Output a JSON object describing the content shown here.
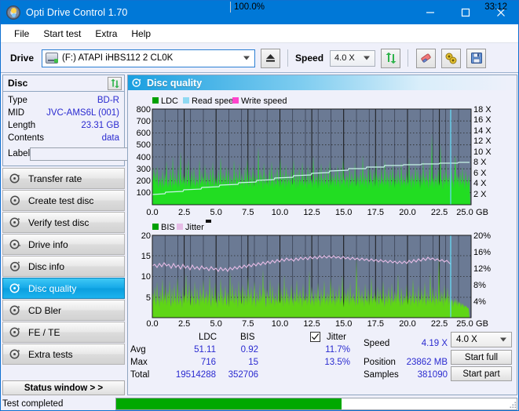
{
  "window": {
    "title": "Opti Drive Control 1.70",
    "icon": "disc-icon",
    "minimize": "–",
    "maximize": "□",
    "close": "✕"
  },
  "menu": {
    "items": [
      {
        "label": "File",
        "name": "menu-file"
      },
      {
        "label": "Start test",
        "name": "menu-start-test"
      },
      {
        "label": "Extra",
        "name": "menu-extra"
      },
      {
        "label": "Help",
        "name": "menu-help"
      }
    ]
  },
  "toolbar": {
    "drive_label": "Drive",
    "drive_value": "(F:)   ATAPI iHBS112  2 CL0K",
    "eject_icon": "eject-icon",
    "speed_label": "Speed",
    "speed_value": "4.0 X",
    "refresh_icon": "refresh-icon",
    "eraser_icon": "eraser-icon",
    "tools_icon": "tools-icon",
    "save_icon": "save-icon"
  },
  "disc_panel": {
    "title": "Disc",
    "refresh_icon": "refresh-icon",
    "rows": [
      {
        "key": "Type",
        "value": "BD-R"
      },
      {
        "key": "MID",
        "value": "JVC-AMS6L (001)"
      },
      {
        "key": "Length",
        "value": "23.31 GB"
      },
      {
        "key": "Contents",
        "value": "data"
      }
    ],
    "label_key": "Label",
    "label_value": "",
    "label_placeholder": "",
    "disc_icon": "cd-icon"
  },
  "nav": {
    "items": [
      {
        "label": "Transfer rate",
        "name": "sidebar-item-transfer-rate",
        "selected": false
      },
      {
        "label": "Create test disc",
        "name": "sidebar-item-create-test-disc",
        "selected": false
      },
      {
        "label": "Verify test disc",
        "name": "sidebar-item-verify-test-disc",
        "selected": false
      },
      {
        "label": "Drive info",
        "name": "sidebar-item-drive-info",
        "selected": false
      },
      {
        "label": "Disc info",
        "name": "sidebar-item-disc-info",
        "selected": false
      },
      {
        "label": "Disc quality",
        "name": "sidebar-item-disc-quality",
        "selected": true
      },
      {
        "label": "CD Bler",
        "name": "sidebar-item-cd-bler",
        "selected": false
      },
      {
        "label": "FE / TE",
        "name": "sidebar-item-fe-te",
        "selected": false
      },
      {
        "label": "Extra tests",
        "name": "sidebar-item-extra-tests",
        "selected": false
      }
    ],
    "status_window_label": "Status window > >"
  },
  "status": {
    "text": "Test completed",
    "progress_percent": "100.0%",
    "elapsed": "33:12",
    "progress_value": 100
  },
  "main": {
    "title": "Disc quality",
    "icon": "disc-quality-icon"
  },
  "stats": {
    "col_ldc": "LDC",
    "col_bis": "BIS",
    "jitter_label": "Jitter",
    "jitter_checked": true,
    "rows": [
      {
        "key": "Avg",
        "ldc": "51.11",
        "bis": "0.92",
        "jitter": "11.7%"
      },
      {
        "key": "Max",
        "ldc": "716",
        "bis": "15",
        "jitter": "13.5%"
      },
      {
        "key": "Total",
        "ldc": "19514288",
        "bis": "352706",
        "jitter": ""
      }
    ],
    "speed_label": "Speed",
    "speed_value": "4.19 X",
    "position_label": "Position",
    "position_value": "23862 MB",
    "samples_label": "Samples",
    "samples_value": "381090",
    "speed_select_value": "4.0 X",
    "start_full_label": "Start full",
    "start_part_label": "Start part"
  },
  "colors": {
    "accent": "#0078d7",
    "plot_bg": "#6b7a94",
    "ldc_green": "#22dd22",
    "bis_green": "#5fd616",
    "jitter_pink": "#e6bce6",
    "read_speed": "#66d9f5",
    "write_speed": "#ff44cc",
    "value_blue": "#2a2ad0",
    "progress_green": "#00a800"
  },
  "chart_data": [
    {
      "type": "area",
      "name": "ldc-chart",
      "title": "",
      "legend": [
        {
          "label": "LDC",
          "color": "#00a000"
        },
        {
          "label": "Read speed",
          "color": "#8fd9f2"
        },
        {
          "label": "Write speed",
          "color": "#ff44cc"
        }
      ],
      "legend_position": "top-left",
      "xlabel": "GB",
      "ylabel": "",
      "xlim": [
        0,
        25
      ],
      "ylim": [
        0,
        800
      ],
      "y2lim": [
        0,
        18
      ],
      "y2label": "X",
      "xticks": [
        0.0,
        2.5,
        5.0,
        7.5,
        10.0,
        12.5,
        15.0,
        17.5,
        20.0,
        22.5,
        25.0
      ],
      "xticklabels": [
        "0.0",
        "2.5",
        "5.0",
        "7.5",
        "10.0",
        "12.5",
        "15.0",
        "17.5",
        "20.0",
        "22.5",
        "25.0"
      ],
      "yticks": [
        100,
        200,
        300,
        400,
        500,
        600,
        700,
        800
      ],
      "yticklabels": [
        "100",
        "200",
        "300",
        "400",
        "500",
        "600",
        "700",
        "800"
      ],
      "y2ticks": [
        2,
        4,
        6,
        8,
        10,
        12,
        14,
        16,
        18
      ],
      "y2ticklabels": [
        "2 X",
        "4 X",
        "6 X",
        "8 X",
        "10 X",
        "12 X",
        "14 X",
        "16 X",
        "18 X"
      ],
      "grid": true,
      "data_end_x": 23.4,
      "marker_x": 23.4,
      "series": [
        {
          "name": "LDC",
          "type": "spikes",
          "color": "#22dd22",
          "baseline_avg": 51,
          "noise_floor": 170,
          "peak_max": 716,
          "description": "Dense green spike band, baseline filled to ~170, spikes mostly 200-450 with occasional peaks to 600-716"
        },
        {
          "name": "Read speed",
          "type": "line",
          "color": "#aaf0e0",
          "description": "Stepped rising read-speed curve from ~2X at 0 GB to ~4.3X at 23 GB",
          "points": [
            [
              0,
              1.9
            ],
            [
              2,
              2.3
            ],
            [
              4,
              2.5
            ],
            [
              6,
              2.7
            ],
            [
              8,
              2.9
            ],
            [
              10,
              3.1
            ],
            [
              12,
              3.3
            ],
            [
              14,
              3.5
            ],
            [
              16,
              3.7
            ],
            [
              18,
              3.9
            ],
            [
              20,
              4.1
            ],
            [
              22,
              4.25
            ],
            [
              23.4,
              4.3
            ]
          ]
        }
      ]
    },
    {
      "type": "area",
      "name": "bis-jitter-chart",
      "title": "",
      "legend": [
        {
          "label": "BIS",
          "color": "#00a000"
        },
        {
          "label": "Jitter",
          "color": "#e6bce6"
        }
      ],
      "legend_position": "top-left",
      "xlabel": "GB",
      "ylabel": "",
      "xlim": [
        0,
        25
      ],
      "ylim": [
        0,
        20
      ],
      "y2lim": [
        0,
        20
      ],
      "y2label": "%",
      "xticks": [
        0.0,
        2.5,
        5.0,
        7.5,
        10.0,
        12.5,
        15.0,
        17.5,
        20.0,
        22.5,
        25.0
      ],
      "xticklabels": [
        "0.0",
        "2.5",
        "5.0",
        "7.5",
        "10.0",
        "12.5",
        "15.0",
        "17.5",
        "20.0",
        "22.5",
        "25.0"
      ],
      "yticks": [
        5,
        10,
        15,
        20
      ],
      "yticklabels": [
        "5",
        "10",
        "15",
        "20"
      ],
      "y2ticks": [
        4,
        8,
        12,
        16,
        20
      ],
      "y2ticklabels": [
        "4%",
        "8%",
        "12%",
        "16%",
        "20%"
      ],
      "grid": true,
      "data_end_x": 23.4,
      "marker_x": 23.4,
      "series": [
        {
          "name": "BIS",
          "type": "spikes",
          "color": "#5fd616",
          "baseline_avg": 0.92,
          "noise_floor": 4.2,
          "peak_max": 15,
          "description": "Dense green spikes filling to ~4, frequent spikes 5-11, rare peaks to 15"
        },
        {
          "name": "Jitter",
          "type": "line",
          "color": "#e6bce6",
          "avg": 11.7,
          "max": 13.5,
          "description": "Pink noisy line oscillating around 11.5-12.5%, rising slightly in the middle"
        }
      ]
    }
  ]
}
